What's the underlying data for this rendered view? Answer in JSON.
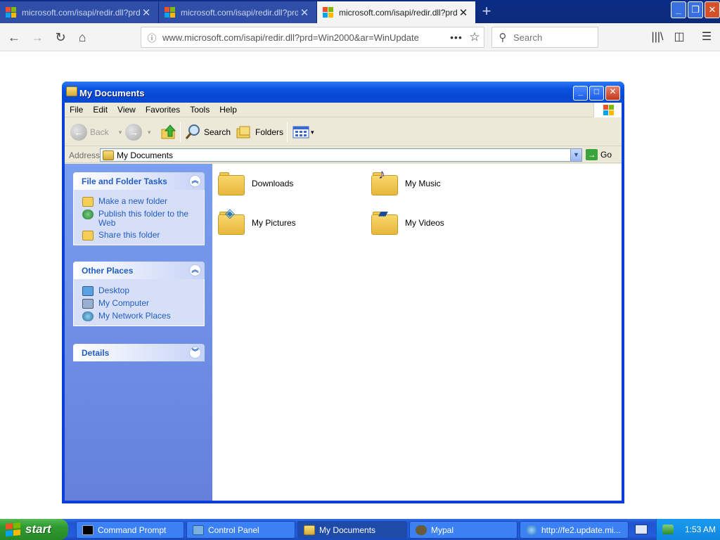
{
  "browser": {
    "tabs": [
      {
        "title": "microsoft.com/isapi/redir.dll?prd=W",
        "active": false
      },
      {
        "title": "microsoft.com/isapi/redir.dll?prd=W",
        "active": false
      },
      {
        "title": "microsoft.com/isapi/redir.dll?prd=W",
        "active": true
      }
    ],
    "new_tab": "+",
    "url": "www.microsoft.com/isapi/redir.dll?prd=Win2000&ar=WinUpdate",
    "search_placeholder": "Search",
    "icons": [
      "back-icon",
      "forward-icon",
      "reload-icon",
      "home-icon",
      "info-icon",
      "more-icon",
      "bookmark-star-icon",
      "library-icon",
      "sidebar-icon",
      "menu-icon"
    ]
  },
  "window": {
    "title": "My Documents",
    "menu": [
      "File",
      "Edit",
      "View",
      "Favorites",
      "Tools",
      "Help"
    ],
    "toolbar": {
      "back": "Back",
      "search": "Search",
      "folders": "Folders"
    },
    "address": {
      "label": "Address",
      "value": "My Documents",
      "go": "Go"
    },
    "panels": [
      {
        "title": "File and Folder Tasks",
        "items": [
          "Make a new folder",
          "Publish this folder to the Web",
          "Share this folder"
        ]
      },
      {
        "title": "Other Places",
        "items": [
          "Desktop",
          "My Computer",
          "My Network Places"
        ]
      },
      {
        "title": "Details",
        "items": []
      }
    ],
    "files": [
      "Downloads",
      "My Music",
      "My Pictures",
      "My Videos"
    ]
  },
  "taskbar": {
    "start": "start",
    "tasks": [
      "Command Prompt",
      "Control Panel",
      "My Documents",
      "Mypal",
      "http://fe2.update.mi..."
    ],
    "clock": "1:53 AM"
  },
  "colors": {
    "xp_blue": "#0a3fd8",
    "panel_link": "#215dc6",
    "start_green": "#2e9a2e"
  }
}
